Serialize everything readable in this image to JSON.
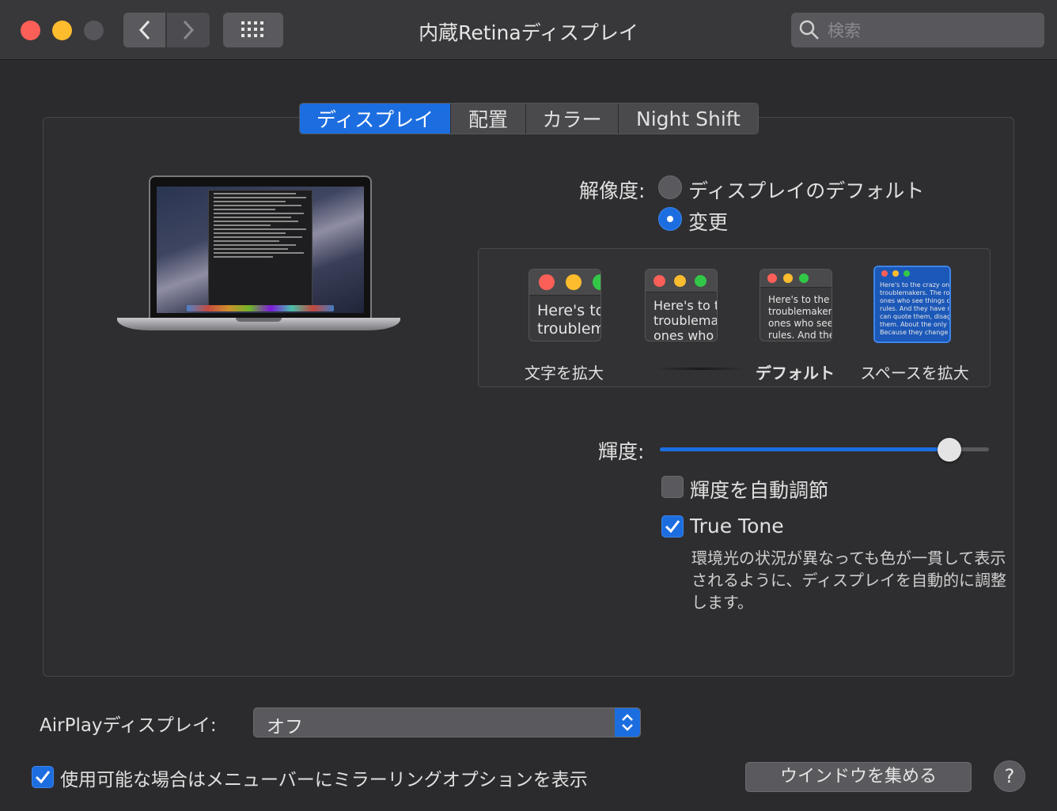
{
  "window": {
    "title": "内蔵Retinaディスプレイ",
    "search_placeholder": "検索"
  },
  "tabs": [
    {
      "label": "ディスプレイ",
      "active": true
    },
    {
      "label": "配置",
      "active": false
    },
    {
      "label": "カラー",
      "active": false
    },
    {
      "label": "Night Shift",
      "active": false
    }
  ],
  "resolution": {
    "label": "解像度:",
    "option_default": "ディスプレイのデフォルト",
    "option_scaled": "変更",
    "selected": "変更",
    "choices": [
      {
        "label": "文字を拡大",
        "preview": "Here's to\ntroublem",
        "bold": false,
        "selected": false
      },
      {
        "label": "",
        "preview": "Here's to t\ntroublema\nones who",
        "bold": false,
        "selected": false
      },
      {
        "label": "デフォルト",
        "preview": "Here's to the cr\ntroublemakers.\nones who see t\nrules. And they",
        "bold": true,
        "selected": false
      },
      {
        "label": "スペースを拡大",
        "preview": "Here's to the crazy one\ntroublemakers. The rou\nones who see things dif\nrules. And they have no\ncan quote them, disagre\nthem. About the only th\nBecause they change th",
        "bold": false,
        "selected": true
      }
    ]
  },
  "brightness": {
    "label": "輝度:",
    "value": 0.9,
    "auto_label": "輝度を自動調節",
    "auto_checked": false
  },
  "true_tone": {
    "label": "True Tone",
    "checked": true,
    "description": "環境光の状況が異なっても色が一貫して表示されるように、ディスプレイを自動的に調整します。"
  },
  "airplay": {
    "label": "AirPlayディスプレイ:",
    "value": "オフ"
  },
  "mirroring": {
    "label": "使用可能な場合はメニューバーにミラーリングオプションを表示",
    "checked": true
  },
  "gather_windows_label": "ウインドウを集める",
  "help_label": "?",
  "colors": {
    "accent": "#1c6ee0",
    "close": "#fc5f57",
    "minimize": "#fdbc2e"
  }
}
